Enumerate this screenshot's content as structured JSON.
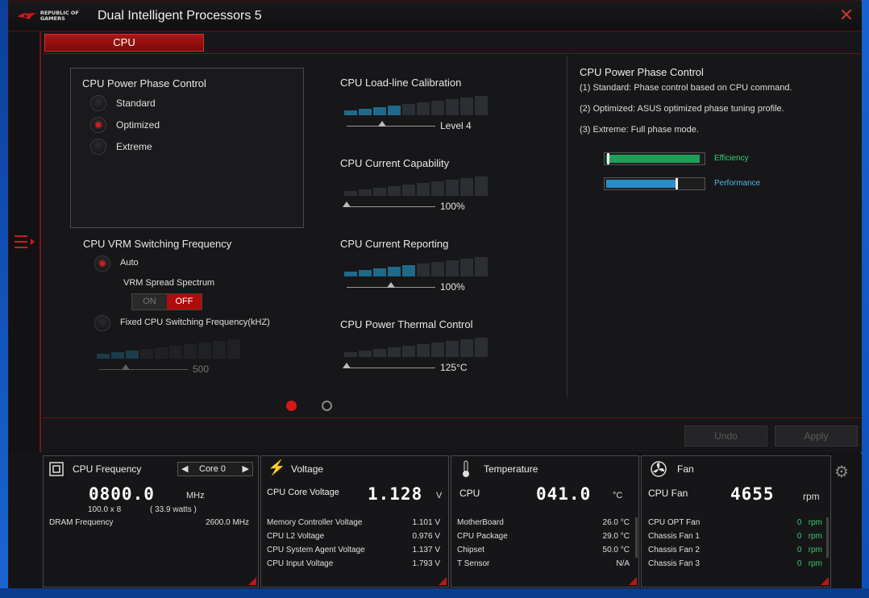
{
  "app": {
    "title": "Dual Intelligent Processors 5",
    "logo_text": "REPUBLIC OF GAMERS"
  },
  "tabs": [
    {
      "label": "CPU"
    }
  ],
  "phase": {
    "title": "CPU Power Phase Control",
    "options": [
      {
        "label": "Standard",
        "selected": false
      },
      {
        "label": "Optimized",
        "selected": true
      },
      {
        "label": "Extreme",
        "selected": false
      }
    ]
  },
  "vrm": {
    "title": "CPU VRM Switching Frequency",
    "auto_label": "Auto",
    "spread_label": "VRM Spread Spectrum",
    "toggle_on": "ON",
    "toggle_off": "OFF",
    "toggle_state": "OFF",
    "fixed_label": "Fixed CPU Switching Frequency(kHZ)",
    "fixed_value": "500",
    "fixed_level": 0.3
  },
  "sliders": [
    {
      "title": "CPU Load-line Calibration",
      "value": "Level 4",
      "level": 0.4
    },
    {
      "title": "CPU Current Capability",
      "value": "100%",
      "level": 0.0
    },
    {
      "title": "CPU Current Reporting",
      "value": "100%",
      "level": 0.5
    },
    {
      "title": "CPU Power Thermal Control",
      "value": "125°C",
      "level": 0.0
    }
  ],
  "info": {
    "title": "CPU Power Phase Control",
    "lines": [
      "(1) Standard: Phase control based on CPU command.",
      "(2) Optimized: ASUS optimized phase tuning profile.",
      "(3) Extreme: Full phase mode."
    ],
    "meters": [
      {
        "label": "Efficiency",
        "level": 0.97,
        "color": "#1fa05a",
        "label_color": "#2fd37a"
      },
      {
        "label": "Performance",
        "level": 0.72,
        "color": "#2a8cc8",
        "label_color": "#4fb8e8"
      }
    ]
  },
  "buttons": {
    "undo": "Undo",
    "apply": "Apply"
  },
  "freq": {
    "title": "CPU Frequency",
    "core": "Core 0",
    "value": "0800.0",
    "unit": "MHz",
    "ratio": "100.0  x  8",
    "watts": "( 33.9   watts )",
    "dram_label": "DRAM Frequency",
    "dram_value": "2600.0  MHz"
  },
  "voltage": {
    "title": "Voltage",
    "main_label": "CPU Core Voltage",
    "main_value": "1.128",
    "unit": "V",
    "rows": [
      {
        "label": "Memory Controller Voltage",
        "value": "1.101  V"
      },
      {
        "label": "CPU L2 Voltage",
        "value": "0.976  V"
      },
      {
        "label": "CPU System Agent Voltage",
        "value": "1.137  V"
      },
      {
        "label": "CPU Input Voltage",
        "value": "1.793  V"
      }
    ]
  },
  "temp": {
    "title": "Temperature",
    "main_label": "CPU",
    "main_value": "041.0",
    "unit": "°C",
    "rows": [
      {
        "label": "MotherBoard",
        "value": "26.0 °C"
      },
      {
        "label": "CPU Package",
        "value": "29.0 °C"
      },
      {
        "label": "Chipset",
        "value": "50.0 °C"
      },
      {
        "label": "T Sensor",
        "value": "N/A"
      }
    ]
  },
  "fan": {
    "title": "Fan",
    "main_label": "CPU Fan",
    "main_value": "4655",
    "unit": "rpm",
    "rows": [
      {
        "label": "CPU OPT Fan",
        "value": "0",
        "unit": "rpm"
      },
      {
        "label": "Chassis Fan 1",
        "value": "0",
        "unit": "rpm"
      },
      {
        "label": "Chassis Fan 2",
        "value": "0",
        "unit": "rpm"
      },
      {
        "label": "Chassis Fan 3",
        "value": "0",
        "unit": "rpm"
      }
    ]
  }
}
